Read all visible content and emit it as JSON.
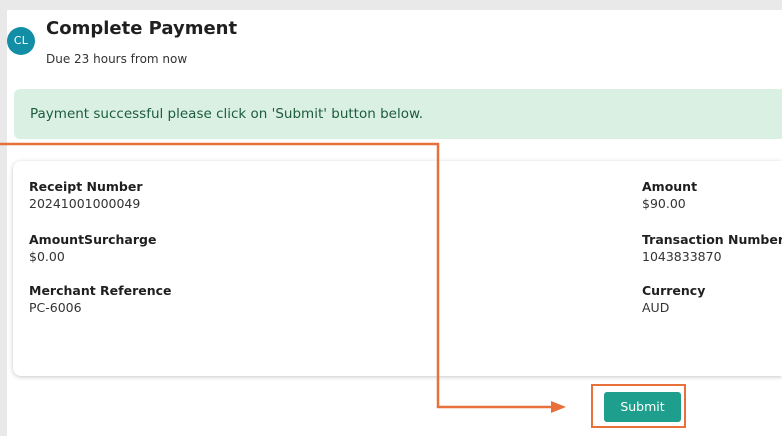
{
  "header": {
    "avatar_initials": "CL",
    "title": "Complete Payment",
    "due_text": "Due 23 hours from now"
  },
  "alert": {
    "message": "Payment successful please click on 'Submit' button below."
  },
  "receipt": {
    "left_fields": [
      {
        "label": "Receipt Number",
        "value": "20241001000049"
      },
      {
        "label": "AmountSurcharge",
        "value": "$0.00"
      },
      {
        "label": "Merchant Reference",
        "value": "PC-6006"
      }
    ],
    "right_fields": [
      {
        "label": "Amount",
        "value": "$90.00"
      },
      {
        "label": "Transaction Number",
        "value": "1043833870"
      },
      {
        "label": "Currency",
        "value": "AUD"
      }
    ]
  },
  "actions": {
    "submit_label": "Submit"
  },
  "colors": {
    "avatar": "#128fa6",
    "alert_bg": "#d9f0e3",
    "alert_text": "#1e5c3a",
    "submit_bg": "#1e9e8c",
    "annotation": "#e8703a"
  }
}
